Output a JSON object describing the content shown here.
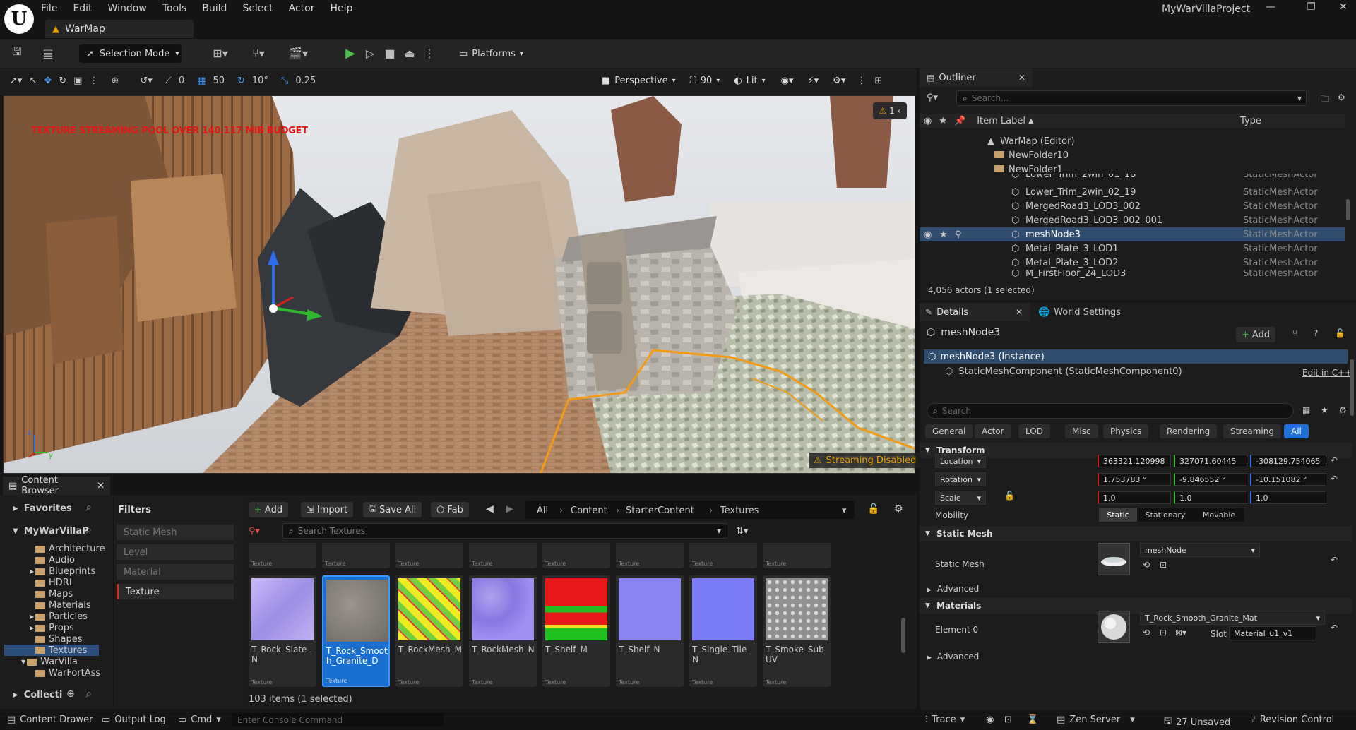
{
  "app": {
    "menu": [
      "File",
      "Edit",
      "Window",
      "Tools",
      "Build",
      "Select",
      "Actor",
      "Help"
    ],
    "map_tab": "WarMap",
    "project_name": "MyWarVillaProject"
  },
  "toolbar": {
    "selection_mode": "Selection Mode",
    "platforms": "Platforms"
  },
  "viewport_toolbar": {
    "rotate_snap_val": "0",
    "grid_snap": "50",
    "rotation_snap": "10°",
    "scale_snap": "0.25",
    "perspective": "Perspective",
    "fov": "90",
    "lit": "Lit"
  },
  "viewport": {
    "texture_pool_warning": "TEXTURE STREAMING POOL OVER 140.117 MiB BUDGET",
    "warning_count": "1",
    "streaming_disabled": "Streaming Disabled"
  },
  "content_browser": {
    "tab_title": "Content Browser",
    "favorites": "Favorites",
    "root": "MyWarVillaP",
    "tree": [
      "Architecture",
      "Audio",
      "Blueprints",
      "HDRI",
      "Maps",
      "Materials",
      "Particles",
      "Props",
      "Shapes",
      "Textures",
      "WarVilla",
      "WarFortAss"
    ],
    "collections": "Collecti",
    "filters_title": "Filters",
    "filters": [
      "Static Mesh",
      "Level",
      "Material",
      "Texture"
    ],
    "add": "Add",
    "import": "Import",
    "save_all": "Save All",
    "fab": "Fab",
    "breadcrumb": [
      "All",
      "Content",
      "StarterContent",
      "Textures"
    ],
    "search_placeholder": "Search Textures",
    "type_label": "Texture",
    "assets": [
      {
        "name": "T_Rock_Slate_N",
        "color": "#b8a8ee"
      },
      {
        "name": "T_Rock_Smooth_Granite_D",
        "color": "#8a847c",
        "selected": true
      },
      {
        "name": "T_RockMesh_M",
        "color": "#e8e020"
      },
      {
        "name": "T_RockMesh_N",
        "color": "#9a88e8"
      },
      {
        "name": "T_Shelf_M",
        "color": "#e81818"
      },
      {
        "name": "T_Shelf_N",
        "color": "#8a84f0"
      },
      {
        "name": "T_Single_Tile_N",
        "color": "#7c7cf8"
      },
      {
        "name": "T_Smoke_SubUV",
        "color": "#b8b8b8"
      }
    ],
    "item_count": "103 items (1 selected)"
  },
  "status_bar": {
    "content_drawer": "Content Drawer",
    "output_log": "Output Log",
    "cmd": "Cmd",
    "console_placeholder": "Enter Console Command",
    "trace": "Trace",
    "zen_server": "Zen Server",
    "unsaved": "27 Unsaved",
    "revision_control": "Revision Control"
  },
  "outliner": {
    "title": "Outliner",
    "search_placeholder": "Search...",
    "col_label": "Item Label",
    "col_type": "Type",
    "rows": [
      {
        "label": "WarMap (Editor)",
        "type": "",
        "indent": 1
      },
      {
        "label": "NewFolder10",
        "type": "",
        "indent": 2
      },
      {
        "label": "NewFolder1",
        "type": "",
        "indent": 2
      },
      {
        "label": "Lower_Trim_2win_01_18",
        "type": "StaticMeshActor",
        "indent": 3
      },
      {
        "label": "Lower_Trim_2win_02_19",
        "type": "StaticMeshActor",
        "indent": 3
      },
      {
        "label": "MergedRoad3_LOD3_002",
        "type": "StaticMeshActor",
        "indent": 3
      },
      {
        "label": "MergedRoad3_LOD3_002_001",
        "type": "StaticMeshActor",
        "indent": 3
      },
      {
        "label": "meshNode3",
        "type": "StaticMeshActor",
        "indent": 3,
        "selected": true
      },
      {
        "label": "Metal_Plate_3_LOD1",
        "type": "StaticMeshActor",
        "indent": 3
      },
      {
        "label": "Metal_Plate_3_LOD2",
        "type": "StaticMeshActor",
        "indent": 3
      },
      {
        "label": "M_FirstFloor_24_LOD3",
        "type": "StaticMeshActor",
        "indent": 3
      }
    ],
    "actor_count": "4,056 actors (1 selected)"
  },
  "details": {
    "tab_details": "Details",
    "tab_world": "World Settings",
    "actor_name": "meshNode3",
    "add": "Add",
    "instance": "meshNode3 (Instance)",
    "component": "StaticMeshComponent (StaticMeshComponent0)",
    "edit_cpp": "Edit in C++",
    "search_placeholder": "Search",
    "categories": [
      "General",
      "Actor",
      "LOD",
      "Misc",
      "Physics",
      "Rendering",
      "Streaming",
      "All"
    ],
    "transform": "Transform",
    "location_label": "Location",
    "location": [
      "363321.120998",
      "327071.60445",
      "-308129.754065"
    ],
    "rotation_label": "Rotation",
    "rotation": [
      "1.753783 °",
      "-9.846552 °",
      "-10.151082 °"
    ],
    "scale_label": "Scale",
    "scale": [
      "1.0",
      "1.0",
      "1.0"
    ],
    "mobility_label": "Mobility",
    "mobility": [
      "Static",
      "Stationary",
      "Movable"
    ],
    "static_mesh_section": "Static Mesh",
    "static_mesh_label": "Static Mesh",
    "static_mesh_value": "meshNode",
    "advanced": "Advanced",
    "materials_section": "Materials",
    "element0_label": "Element 0",
    "element0_value": "T_Rock_Smooth_Granite_Mat",
    "slot_label": "Slot",
    "slot_value": "Material_u1_v1",
    "advanced2": "Advanced"
  }
}
